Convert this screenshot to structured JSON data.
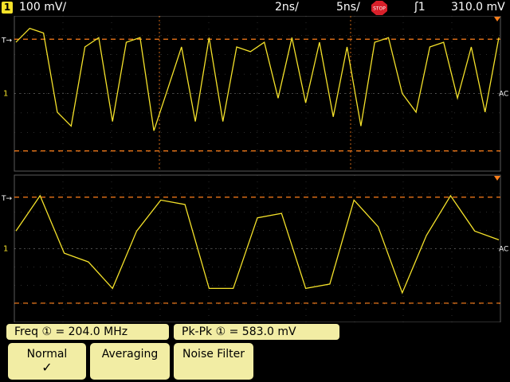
{
  "status_bar": {
    "channel": "1",
    "volts_per_div": "100",
    "volts_unit": "mV/",
    "time_per_div": "2ns/",
    "sample": "5ns/",
    "run_state": "STOP",
    "trigger_source": "1",
    "trigger_level": "310.0 mV"
  },
  "waveform_labels": {
    "ground_marker": "1",
    "coupling": "AC",
    "trigger_marker": "T"
  },
  "measurements": [
    {
      "label": "Freq",
      "channel": "1",
      "value": "= 204.0 MHz"
    },
    {
      "label": "Pk-Pk",
      "channel": "1",
      "value": "= 583.0 mV"
    }
  ],
  "softkeys": [
    {
      "label": "Normal",
      "check": "✓"
    },
    {
      "label": "Averaging",
      "check": ""
    },
    {
      "label": "Noise Filter",
      "check": ""
    }
  ],
  "colors": {
    "trace": "#f5e22a",
    "cursor": "#ff7f1a",
    "grid": "#5a5a5a",
    "softkey_bg": "#f2eda4"
  },
  "chart_data": [
    {
      "type": "line",
      "series": [
        {
          "values": [
            0.55,
            0.7,
            0.65,
            -0.2,
            -0.35,
            0.5,
            0.6,
            -0.3,
            0.55,
            0.6,
            -0.4,
            0.05,
            0.5,
            -0.3,
            0.6,
            -0.3,
            0.5,
            0.45,
            0.55,
            -0.05,
            0.6,
            -0.1,
            0.55,
            -0.25,
            0.5,
            -0.35,
            0.55,
            0.6,
            0.0,
            -0.2,
            0.5,
            0.55,
            -0.05,
            0.5,
            -0.2,
            0.6
          ]
        }
      ]
    },
    {
      "type": "line",
      "series": [
        {
          "values": [
            0.2,
            0.6,
            -0.05,
            -0.15,
            -0.45,
            0.2,
            0.55,
            0.5,
            -0.45,
            -0.45,
            0.35,
            0.4,
            -0.45,
            -0.4,
            0.55,
            0.25,
            -0.5,
            0.15,
            0.6,
            0.2,
            0.1
          ]
        }
      ]
    }
  ]
}
